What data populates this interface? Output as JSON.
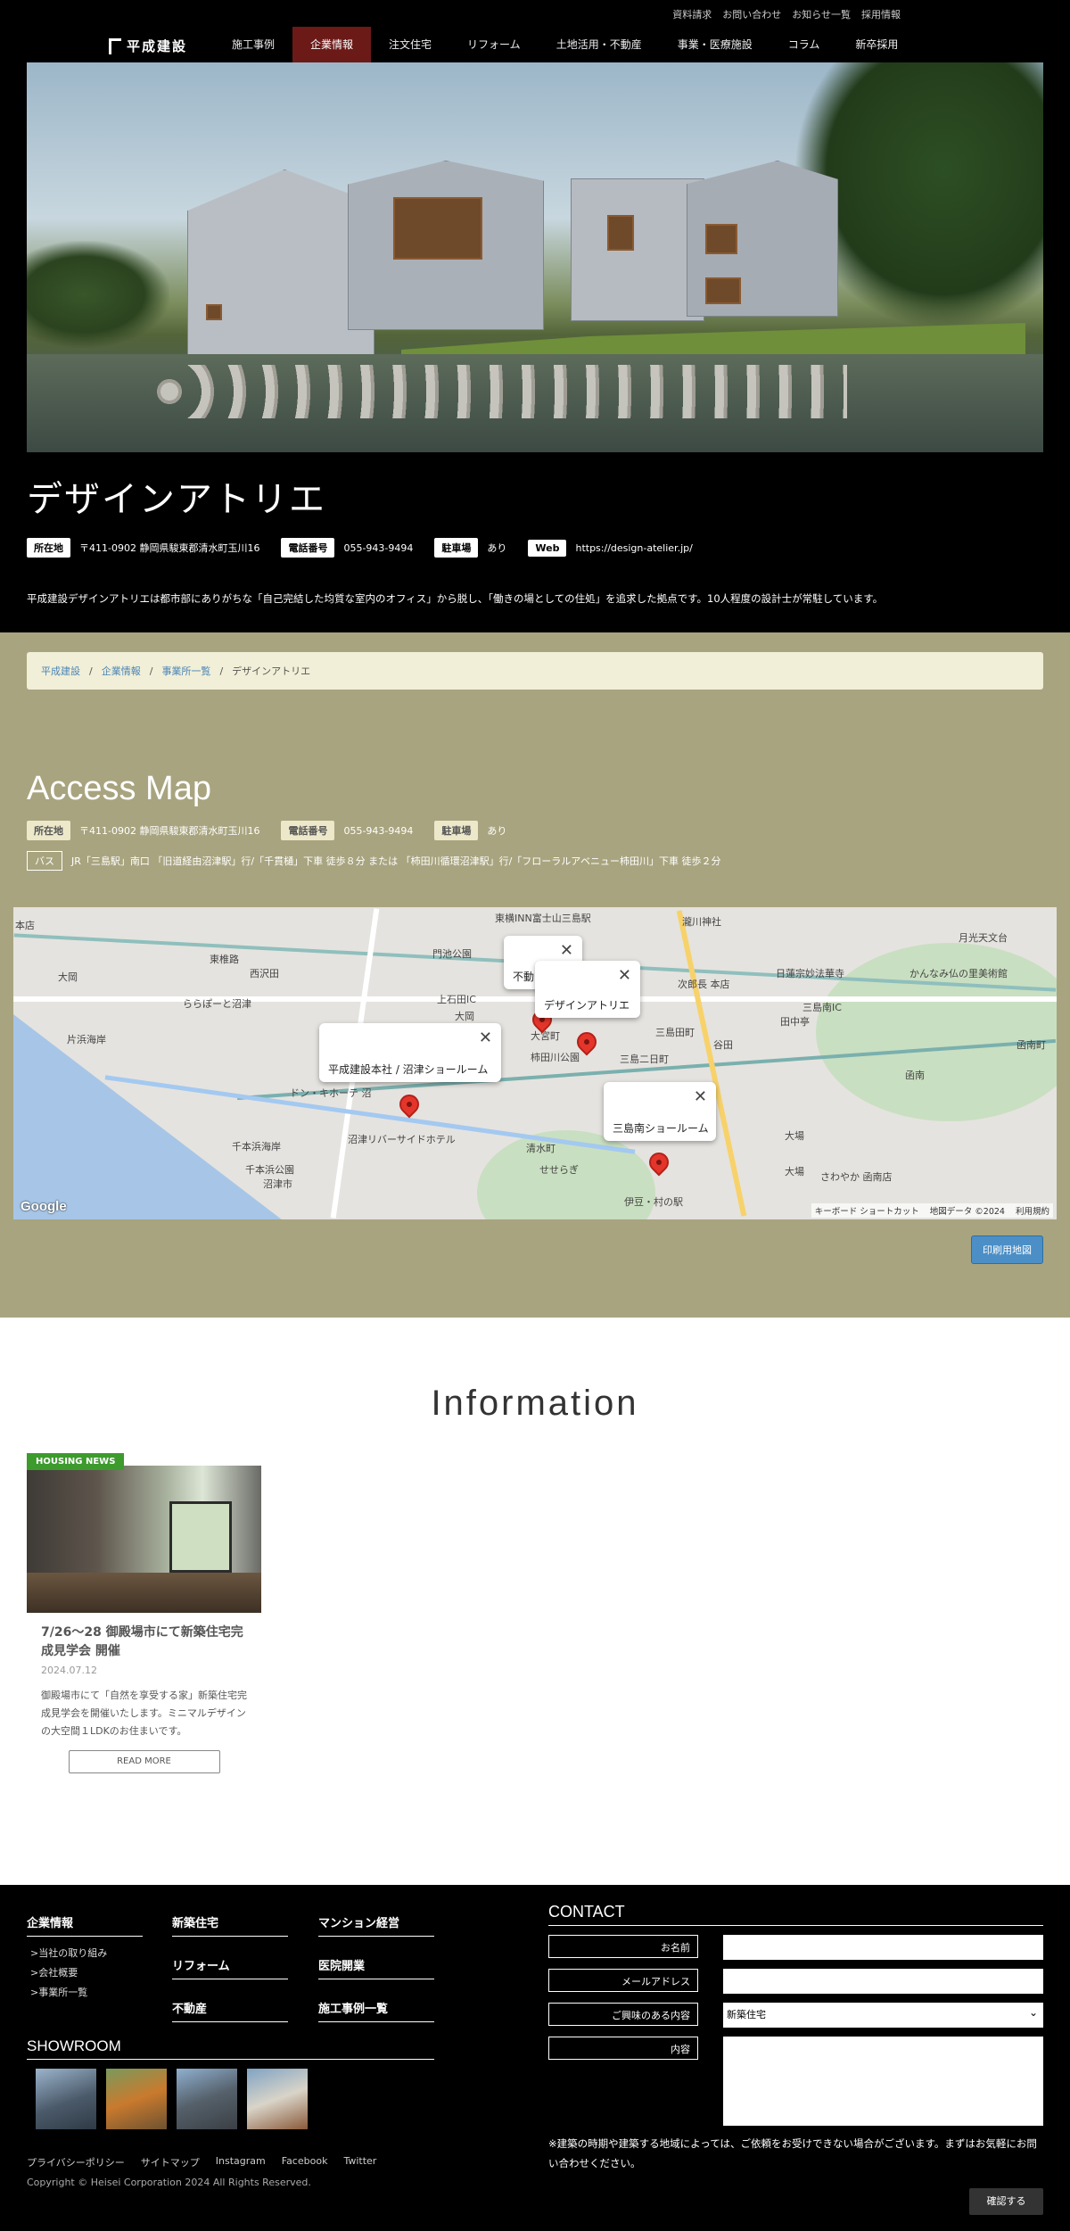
{
  "header": {
    "top_links": [
      "資料請求",
      "お問い合わせ",
      "お知らせ一覧",
      "採用情報"
    ],
    "logo_text": "平成建設",
    "nav": [
      "施工事例",
      "企業情報",
      "注文住宅",
      "リフォーム",
      "土地活用・不動産",
      "事業・医療施設",
      "コラム",
      "新卒採用"
    ],
    "active_nav": "企業情報"
  },
  "title_section": {
    "title": "デザインアトリエ",
    "address_label": "所在地",
    "address": "〒411-0902 静岡県駿東郡清水町玉川16",
    "phone_label": "電話番号",
    "phone": "055-943-9494",
    "parking_label": "駐車場",
    "parking": "あり",
    "web_label": "Web",
    "web": "https://design-atelier.jp/",
    "description": "平成建設デザインアトリエは都市部にありがちな「自己完結した均質な室内のオフィス」から脱し、「働きの場としての住処」を追求した拠点です。10人程度の設計士が常駐しています。"
  },
  "breadcrumb": [
    "平成建設",
    "企業情報",
    "事業所一覧",
    "デザインアトリエ"
  ],
  "access": {
    "heading": "Access Map",
    "address_label": "所在地",
    "address": "〒411-0902 静岡県駿東郡清水町玉川16",
    "phone_label": "電話番号",
    "phone": "055-943-9494",
    "parking_label": "駐車場",
    "parking": "あり",
    "bus_label": "バス",
    "bus": "JR「三島駅」南口 「旧道経由沼津駅」行/「千貫樋」下車 徒歩８分 または 「柿田川循環沼津駅」行/「フローラルアベニュー柿田川」下車 徒歩２分",
    "print_button": "印刷用地図"
  },
  "map": {
    "popups": [
      "不動",
      "デザインアトリエ",
      "平成建設本社 / 沼津ショールーム",
      "三島南ショールーム"
    ],
    "labels": [
      "東横INN富士山三島駅",
      "瀧川神社",
      "月光天文台",
      "本店",
      "門池公園",
      "東椎路",
      "西沢田",
      "大岡",
      "次郎長 本店",
      "日蓮宗妙法華寺",
      "かんなみ仏の里美術館",
      "ららぽーと沼津",
      "片浜海岸",
      "大岡",
      "柿田川公園",
      "三島二日町",
      "三島田町",
      "田中亭",
      "谷田",
      "函南町",
      "千本浜海岸",
      "千本浜公園",
      "沼津市",
      "ドン・キホーテ 沼",
      "沼津リバーサイドホテル",
      "清水町",
      "せせらぎ",
      "伊豆・村の駅",
      "大場",
      "さわやか 函南店",
      "函南",
      "三島南IC",
      "上石田IC",
      "大宮町",
      "大場"
    ],
    "google": "Google",
    "credits": [
      "キーボード ショートカット",
      "地図データ ©2024",
      "利用規約"
    ]
  },
  "information": {
    "heading": "Information",
    "card": {
      "badge": "HOUSING NEWS",
      "title": "7/26〜28 御殿場市にて新築住宅完成見学会 開催",
      "date": "2024.07.12",
      "text": "御殿場市にて「自然を享受する家」新築住宅完成見学会を開催いたします。ミニマルデザインの大空間１LDKのお住まいです。",
      "button": "READ MORE"
    }
  },
  "footer": {
    "col1_title": "企業情報",
    "col1_links": [
      ">当社の取り組み",
      ">会社概要",
      ">事業所一覧"
    ],
    "col2_titles": [
      "新築住宅",
      "リフォーム",
      "不動産"
    ],
    "col3_titles": [
      "マンション経営",
      "医院開業",
      "施工事例一覧"
    ],
    "showroom_title": "SHOWROOM",
    "links": [
      "プライバシーポリシー",
      "サイトマップ",
      "Instagram",
      "Facebook",
      "Twitter"
    ],
    "copyright": "Copyright © Heisei Corporation 2024 All Rights Reserved.",
    "contact_title": "CONTACT",
    "form": {
      "name_label": "お名前",
      "email_label": "メールアドレス",
      "interest_label": "ご興味のある内容",
      "interest_value": "新築住宅",
      "content_label": "内容"
    },
    "note": "※建築の時期や建築する地域によっては、ご依頼をお受けできない場合がございます。まずはお気軽にお問い合わせください。",
    "confirm": "確認する"
  },
  "colors": {
    "nav_active": "#6b1a18",
    "access_bg": "#a8a47f",
    "breadcrumb_bg": "#f1efd7",
    "badge_green": "#3d9a2d",
    "print_blue": "#4b8fc6"
  }
}
